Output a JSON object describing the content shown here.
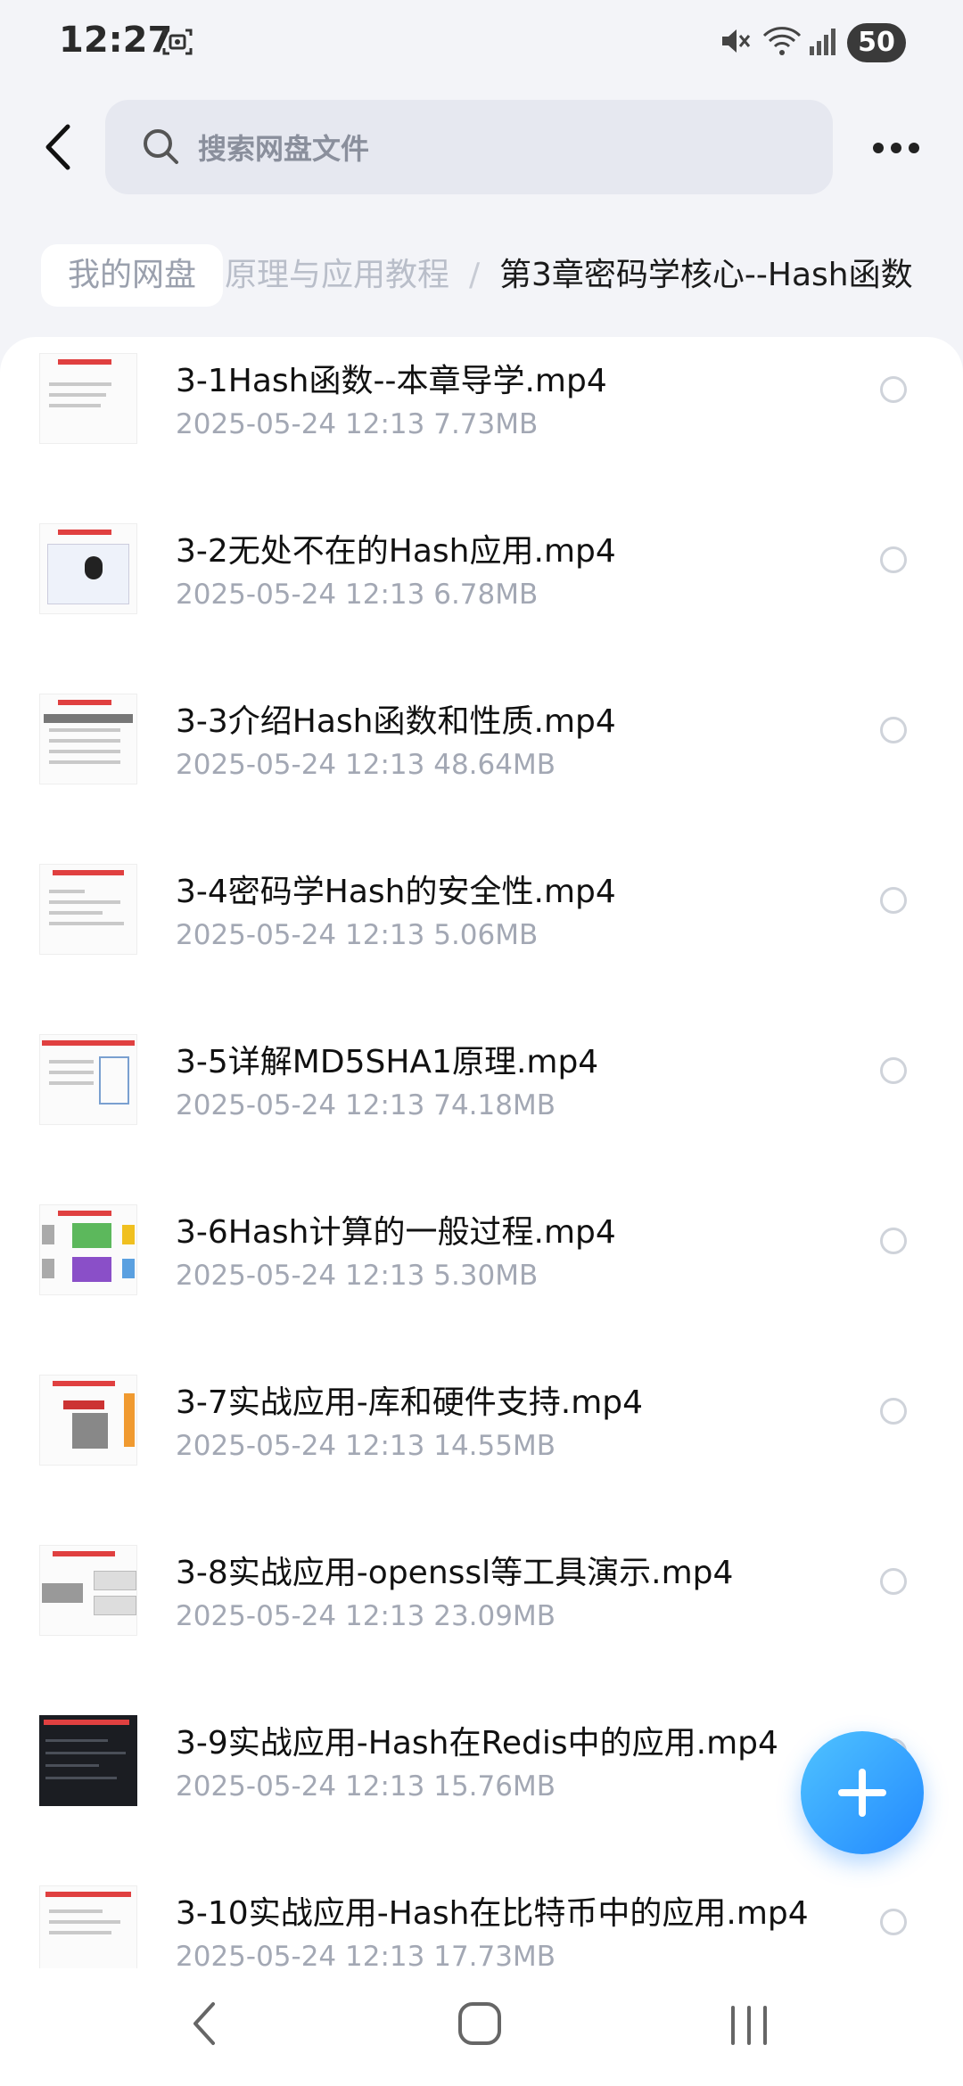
{
  "status_bar": {
    "time": "12:27",
    "battery": "50",
    "icons": [
      "screenshot-icon",
      "mute-icon",
      "wifi-icon",
      "signal-icon"
    ]
  },
  "header": {
    "search_placeholder": "搜索网盘文件",
    "icons": [
      "back-arrow-icon",
      "search-icon",
      "more-dots-icon"
    ]
  },
  "breadcrumb": {
    "root": "我的网盘",
    "middle": "原理与应用教程",
    "separator": "/",
    "current": "第3章密码学核心--Hash函数"
  },
  "files": [
    {
      "name": "3-1Hash函数--本章导学.mp4",
      "date": "2025-05-24",
      "time": "12:13",
      "size": "7.73MB"
    },
    {
      "name": "3-2无处不在的Hash应用.mp4",
      "date": "2025-05-24",
      "time": "12:13",
      "size": "6.78MB"
    },
    {
      "name": "3-3介绍Hash函数和性质.mp4",
      "date": "2025-05-24",
      "time": "12:13",
      "size": "48.64MB"
    },
    {
      "name": "3-4密码学Hash的安全性.mp4",
      "date": "2025-05-24",
      "time": "12:13",
      "size": "5.06MB"
    },
    {
      "name": "3-5详解MD5SHA1原理.mp4",
      "date": "2025-05-24",
      "time": "12:13",
      "size": "74.18MB"
    },
    {
      "name": "3-6Hash计算的一般过程.mp4",
      "date": "2025-05-24",
      "time": "12:13",
      "size": "5.30MB"
    },
    {
      "name": "3-7实战应用-库和硬件支持.mp4",
      "date": "2025-05-24",
      "time": "12:13",
      "size": "14.55MB"
    },
    {
      "name": "3-8实战应用-openssl等工具演示.mp4",
      "date": "2025-05-24",
      "time": "12:13",
      "size": "23.09MB"
    },
    {
      "name": "3-9实战应用-Hash在Redis中的应用.mp4",
      "date": "2025-05-24",
      "time": "12:13",
      "size": "15.76MB"
    },
    {
      "name": "3-10实战应用-Hash在比特币中的应用.mp4",
      "date": "2025-05-24",
      "time": "12:13",
      "size": "17.73MB"
    }
  ],
  "fab": {
    "icon": "plus-icon"
  },
  "nav_bar": {
    "icons": [
      "nav-back-icon",
      "nav-home-icon",
      "nav-recents-icon"
    ]
  },
  "colors": {
    "accent": "#2389ff",
    "text_secondary": "#a3a8b4",
    "background": "#f3f4f8"
  }
}
